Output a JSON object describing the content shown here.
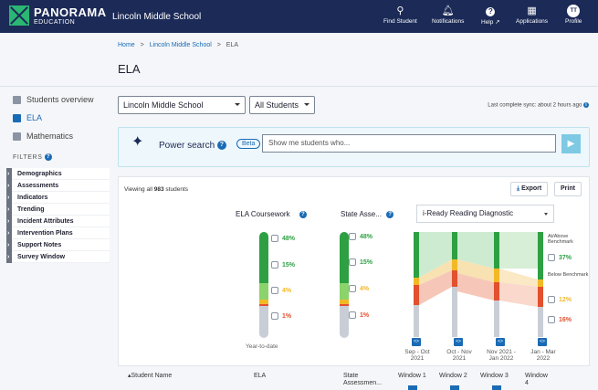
{
  "header": {
    "brand": "PANORAMA",
    "brand_sub": "EDUCATION",
    "school": "Lincoln Middle School",
    "nav": [
      {
        "label": "Find Student",
        "icon": "search-icon"
      },
      {
        "label": "Notifications",
        "icon": "bell-icon"
      },
      {
        "label": "Help ↗",
        "icon": "help-icon"
      },
      {
        "label": "Applications",
        "icon": "grid-icon"
      },
      {
        "label": "Profile",
        "icon": "avatar",
        "initials": "TT"
      }
    ]
  },
  "breadcrumb": {
    "home": "Home",
    "school": "Lincoln Middle School",
    "current": "ELA",
    "sep": ">"
  },
  "page_title": "ELA",
  "sidebar": {
    "items": [
      {
        "label": "Students overview",
        "icon": "students-icon"
      },
      {
        "label": "ELA",
        "icon": "book-icon"
      },
      {
        "label": "Mathematics",
        "icon": "calculator-icon"
      }
    ],
    "filters_label": "FILTERS",
    "filters": [
      "Demographics",
      "Assessments",
      "Indicators",
      "Trending",
      "Incident Attributes",
      "Intervention Plans",
      "Support Notes",
      "Survey Window"
    ]
  },
  "controls": {
    "school_select": "Lincoln Middle School",
    "students_select": "All Students",
    "sync": "Last complete sync: about 2 hours ago"
  },
  "power_search": {
    "label": "Power search",
    "beta": "Beta",
    "placeholder": "Show me students who...",
    "submit_icon": "arrow-right-icon"
  },
  "card": {
    "viewing_prefix": "Viewing all ",
    "student_count": "983",
    "viewing_suffix": " students",
    "export": "Export",
    "print": "Print",
    "ela_coursework": "ELA Coursework",
    "state_assessment": "State Asse...",
    "iready_select": "i-Ready Reading Diagnostic",
    "ytd": "Year-to-date",
    "ela_pcts": [
      "48%",
      "15%",
      "4%",
      "1%"
    ],
    "state_pcts": [
      "48%",
      "15%",
      "4%",
      "1%"
    ],
    "legend_at": "At/Above Benchmark",
    "legend_below": "Below Benchmark",
    "iready_pcts": [
      "37%",
      "12%",
      "16%"
    ],
    "windows": [
      "Sep - Oct 2021",
      "Oct - Nov 2021",
      "Nov 2021 - Jan 2022",
      "Jan - Mar 2022"
    ]
  },
  "table": {
    "headers": [
      "Student Name",
      "ELA",
      "State Assessmen...",
      "Window 1",
      "Window 2",
      "Window 3",
      "Window 4"
    ]
  },
  "colors": {
    "nav": "#1b2a57",
    "accent": "#1a6bb5",
    "green": "#2ea043",
    "light_green": "#8bd36b",
    "yellow": "#f2b927",
    "red": "#e2502f",
    "gray": "#c9ced6"
  }
}
